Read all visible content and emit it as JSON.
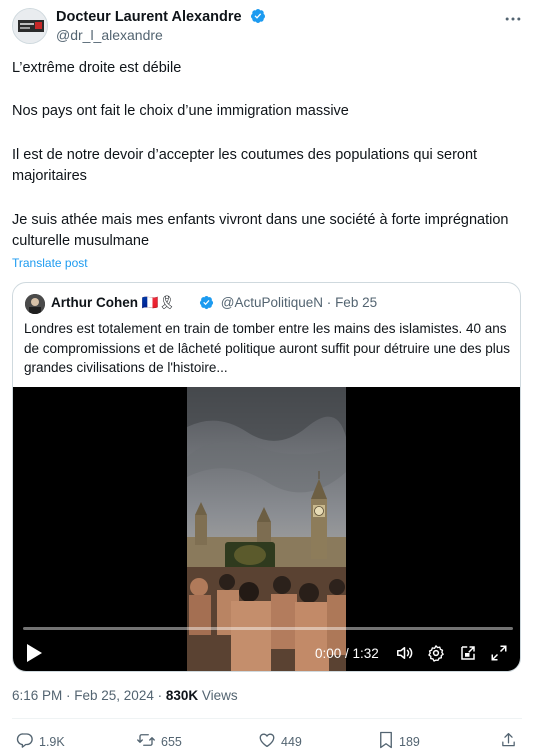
{
  "author": {
    "name": "Docteur Laurent Alexandre",
    "handle": "@dr_l_alexandre"
  },
  "post": {
    "paragraphs": [
      "L’extrême droite est débile",
      "Nos pays ont fait le choix d’une immigration massive",
      "Il est de notre devoir d’accepter les coutumes des populations qui seront majoritaires",
      "Je suis athée mais mes enfants vivront dans une société à forte imprégnation culturelle musulmane"
    ],
    "translate_label": "Translate post"
  },
  "quote": {
    "name": "Arthur Cohen",
    "name_emoji": "🇫🇷🎗",
    "handle": "@ActuPolitiqueN",
    "separator": "·",
    "date": "Feb 25",
    "text": "Londres est totalement en train de tomber entre les mains des islamistes. 40 ans de compromissions et de lâcheté politique auront suffit pour détruire une des plus grandes civilisations de l'histoire...",
    "video": {
      "time_display": "0:00 / 1:32",
      "progress": 0.0
    }
  },
  "meta": {
    "time": "6:16 PM · Feb 25, 2024 ·",
    "views_count": "830K",
    "views_label": "Views"
  },
  "actions": {
    "replies": "1.9K",
    "reposts": "655",
    "likes": "449",
    "bookmarks": "189"
  },
  "icons": [
    "verified-badge-icon",
    "more-icon",
    "play-icon",
    "volume-icon",
    "settings-icon",
    "pip-icon",
    "fullscreen-icon",
    "reply-icon",
    "repost-icon",
    "like-icon",
    "bookmark-icon",
    "share-icon"
  ],
  "colors": {
    "accent": "#1d9bf0",
    "muted": "#536471",
    "text": "#0f1419",
    "border": "#cfd9de"
  }
}
